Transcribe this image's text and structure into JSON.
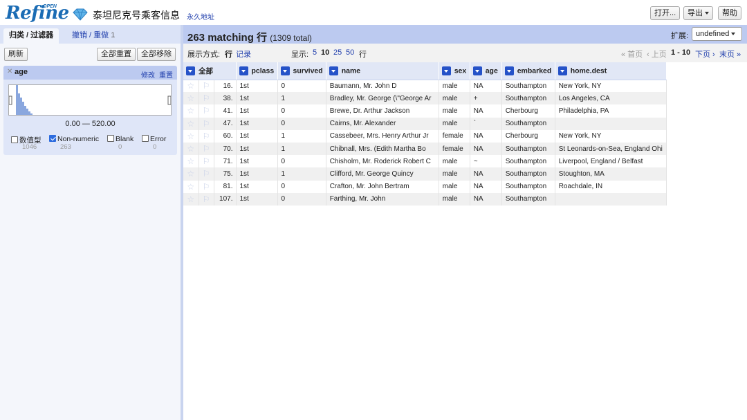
{
  "header": {
    "logo_text": "Refine",
    "logo_super": "OPEN",
    "project_title": "泰坦尼克号乘客信息",
    "permalink": "永久地址",
    "open_button": "打开...",
    "export_button": "导出",
    "help_button": "帮助"
  },
  "left": {
    "tabs": {
      "facets": "归类 / 过滤器",
      "undo": "撤销 / 重做",
      "undo_count": "1"
    },
    "refresh": "刷新",
    "reset_all": "全部重置",
    "remove_all": "全部移除",
    "facet": {
      "name": "age",
      "edit": "修改",
      "reset": "重置",
      "range": "0.00 — 520.00",
      "options": [
        {
          "label": "数值型",
          "count": "1046",
          "checked": false
        },
        {
          "label": "Non-numeric",
          "count": "263",
          "checked": true
        },
        {
          "label": "Blank",
          "count": "0",
          "checked": false
        },
        {
          "label": "Error",
          "count": "0",
          "checked": false
        }
      ]
    }
  },
  "summary": {
    "matching": "263 matching 行",
    "total": "(1309 total)",
    "extension_label": "扩展:",
    "extension_value": "undefined"
  },
  "view": {
    "show_as_label": "展示方式:",
    "rows_label": "行",
    "records_label": "记录",
    "show_label": "显示:",
    "page_sizes": [
      "5",
      "10",
      "25",
      "50"
    ],
    "rows_unit": "行",
    "first": "« 首页",
    "prev": "‹ 上页",
    "range": "1 - 10",
    "next": "下页 ›",
    "last": "末页 »"
  },
  "table": {
    "all_label": "全部",
    "columns": [
      "pclass",
      "survived",
      "name",
      "sex",
      "age",
      "embarked",
      "home.dest"
    ],
    "rows": [
      {
        "idx": "16.",
        "cells": [
          "1st",
          "0",
          "Baumann, Mr. John D",
          "male",
          "NA",
          "Southampton",
          "New York, NY"
        ]
      },
      {
        "idx": "38.",
        "cells": [
          "1st",
          "1",
          "Bradley, Mr. George (\\\"George Ar",
          "male",
          "+",
          "Southampton",
          "Los Angeles, CA"
        ]
      },
      {
        "idx": "41.",
        "cells": [
          "1st",
          "0",
          "Brewe, Dr. Arthur Jackson",
          "male",
          "NA",
          "Cherbourg",
          "Philadelphia, PA"
        ]
      },
      {
        "idx": "47.",
        "cells": [
          "1st",
          "0",
          "Cairns, Mr. Alexander",
          "male",
          "`",
          "Southampton",
          ""
        ]
      },
      {
        "idx": "60.",
        "cells": [
          "1st",
          "1",
          "Cassebeer, Mrs. Henry Arthur Jr",
          "female",
          "NA",
          "Cherbourg",
          "New York, NY"
        ]
      },
      {
        "idx": "70.",
        "cells": [
          "1st",
          "1",
          "Chibnall, Mrs. (Edith Martha Bo",
          "female",
          "NA",
          "Southampton",
          "St Leonards-on-Sea, England Ohi"
        ]
      },
      {
        "idx": "71.",
        "cells": [
          "1st",
          "0",
          "Chisholm, Mr. Roderick Robert C",
          "male",
          "~",
          "Southampton",
          "Liverpool, England / Belfast"
        ]
      },
      {
        "idx": "75.",
        "cells": [
          "1st",
          "1",
          "Clifford, Mr. George Quincy",
          "male",
          "NA",
          "Southampton",
          "Stoughton, MA"
        ]
      },
      {
        "idx": "81.",
        "cells": [
          "1st",
          "0",
          "Crafton, Mr. John Bertram",
          "male",
          "NA",
          "Southampton",
          "Roachdale, IN"
        ]
      },
      {
        "idx": "107.",
        "cells": [
          "1st",
          "0",
          "Farthing, Mr. John",
          "male",
          "NA",
          "Southampton",
          ""
        ]
      }
    ]
  },
  "colors": {
    "accent": "#2552c8",
    "header_band": "#bccaf0",
    "link": "#2240ad",
    "logo": "#1b6cb4"
  }
}
